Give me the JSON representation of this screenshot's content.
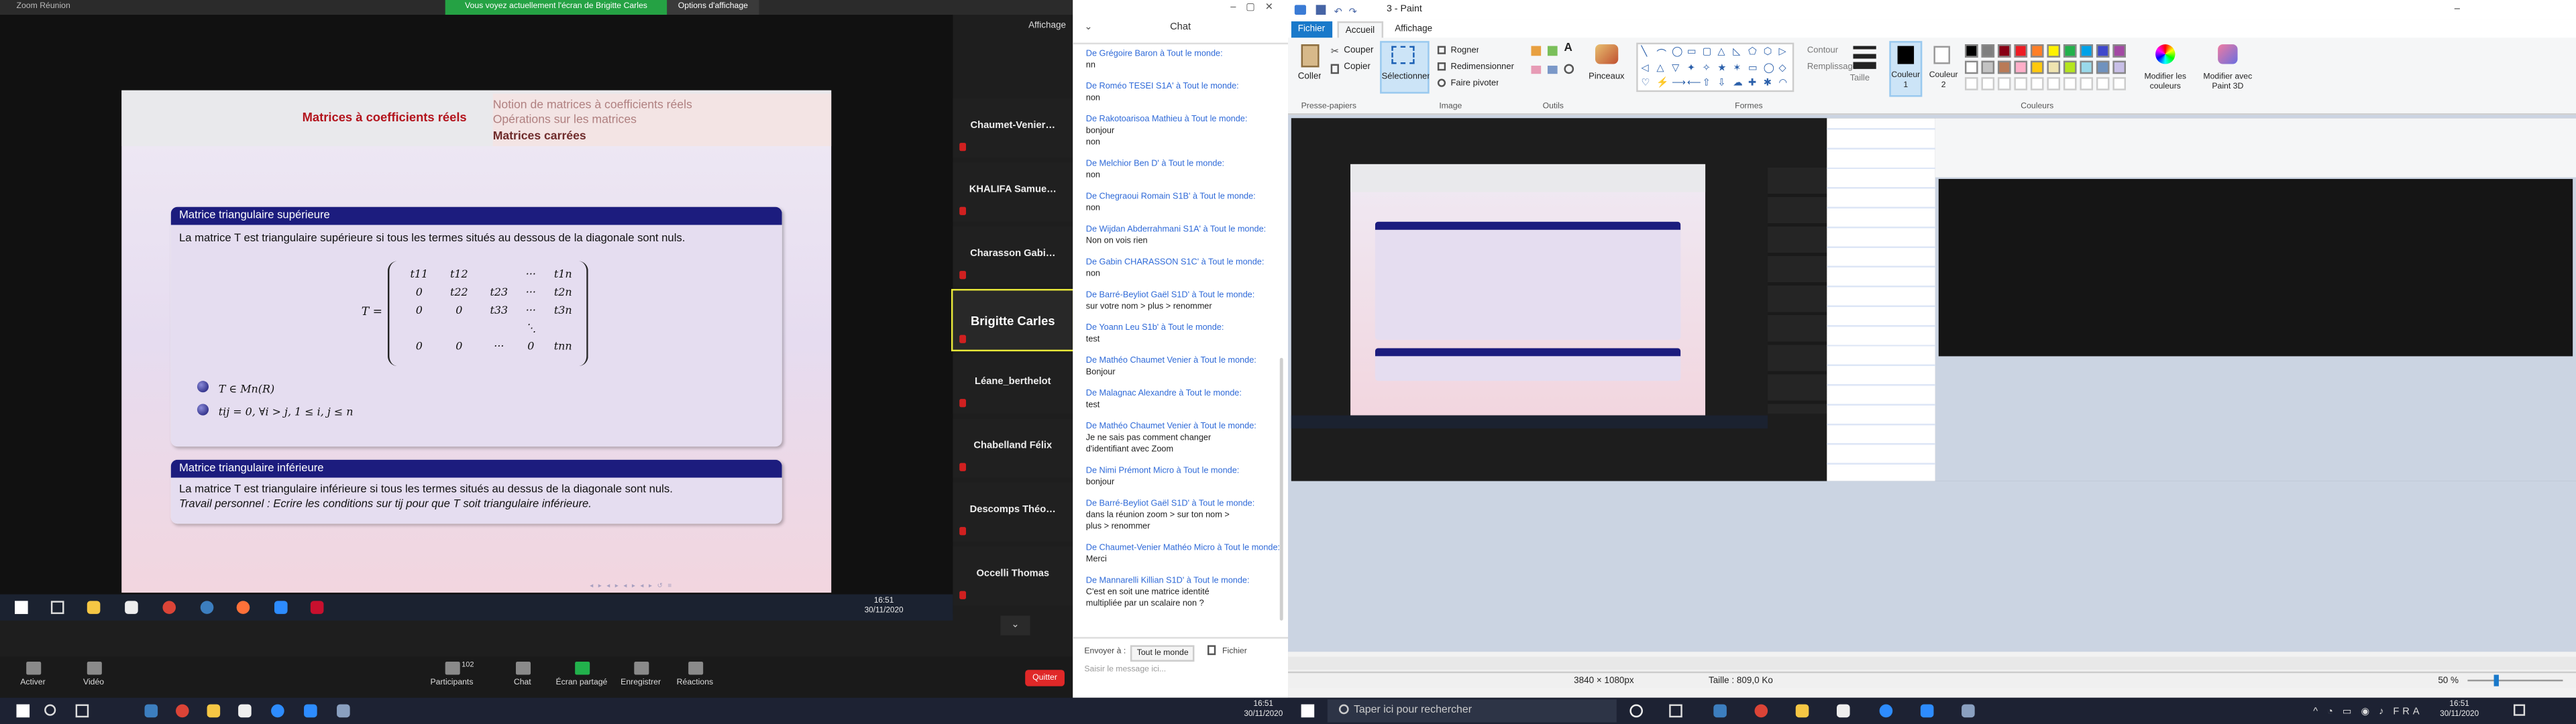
{
  "zoom": {
    "title": "Zoom Réunion",
    "banner": "Vous voyez actuellement l'écran de Brigitte Carles",
    "banner_options": "Options d'affichage",
    "view_label": "Affichage",
    "slide": {
      "title_red": "Matrices à coefficients réels",
      "nav": [
        "Notion de matrices à coefficients réels",
        "Opérations sur les matrices",
        "Matrices carrées"
      ],
      "block1_title": "Matrice triangulaire supérieure",
      "block1_text": "La matrice T est triangulaire supérieure si tous les termes situés au dessous de la diagonale sont nuls.",
      "T_label": "T =",
      "mat_rows": [
        [
          "t11",
          "t12",
          "",
          "···",
          "t1n"
        ],
        [
          "0",
          "t22",
          "t23",
          "···",
          "t2n"
        ],
        [
          "0",
          "0",
          "t33",
          "···",
          "t3n"
        ],
        [
          "",
          "",
          "",
          "⋱",
          ""
        ],
        [
          "0",
          "0",
          "···",
          "0",
          "tnn"
        ]
      ],
      "bullet1": "T ∈ Mn(R)",
      "bullet2": "tij = 0, ∀i > j, 1 ≤ i, j ≤ n",
      "block2_title": "Matrice triangulaire inférieure",
      "block2_text": "La matrice T est triangulaire inférieure si tous les termes situés au dessus de la diagonale sont nuls.",
      "block2_italic": "Travail personnel : Ecrire les conditions sur tij pour que T soit triangulaire inférieure."
    },
    "participants_tiles": [
      "Chaumet-Venier…",
      "KHALIFA Samue…",
      "Charasson Gabi…",
      "Brigitte Carles",
      "Léane_berthelot",
      "Chabelland Félix",
      "Descomps Théo…",
      "Occelli Thomas"
    ],
    "remote_time": "16:51",
    "remote_date": "30/11/2020",
    "controls": [
      {
        "label": "Activer",
        "color": "#8a8a8a"
      },
      {
        "label": "Vidéo",
        "color": "#8a8a8a"
      },
      {
        "label": "Participants",
        "color": "#8a8a8a",
        "count": "102"
      },
      {
        "label": "Chat",
        "color": "#8a8a8a"
      },
      {
        "label": "Écran partagé",
        "color": "#22b14c"
      },
      {
        "label": "Enregistrer",
        "color": "#8a8a8a"
      },
      {
        "label": "Réactions",
        "color": "#8a8a8a"
      }
    ],
    "quit": "Quitter"
  },
  "chat": {
    "title": "Chat",
    "messages": [
      {
        "from": "De Grégoire Baron à Tout le monde:",
        "body": "nn"
      },
      {
        "from": "De Roméo TESEI S1A' à Tout le monde:",
        "body": "non"
      },
      {
        "from": "De Rakotoarisoa Mathieu à Tout le monde:",
        "body": "bonjour\nnon"
      },
      {
        "from": "De Melchior Ben D' à Tout le monde:",
        "body": "non"
      },
      {
        "from": "De Chegraoui Romain S1B' à Tout le monde:",
        "body": "non"
      },
      {
        "from": "De Wijdan Abderrahmani S1A' à Tout le monde:",
        "body": "Non on vois rien"
      },
      {
        "from": "De Gabin CHARASSON S1C' à Tout le monde:",
        "body": "non"
      },
      {
        "from": "De Barré-Beyliot Gaël S1D' à Tout le monde:",
        "body": "sur votre nom > plus > renommer"
      },
      {
        "from": "De Yoann Leu S1b' à Tout le monde:",
        "body": "test"
      },
      {
        "from": "De Mathéo Chaumet Venier à Tout le monde:",
        "body": "Bonjour"
      },
      {
        "from": "De Malagnac Alexandre à Tout le monde:",
        "body": "test"
      },
      {
        "from": "De Mathéo Chaumet Venier à Tout le monde:",
        "body": "Je ne sais pas comment changer\nd'identifiant avec Zoom"
      },
      {
        "from": "De Nimi Prémont Micro à Tout le monde:",
        "body": "bonjour"
      },
      {
        "from": "De Barré-Beyliot Gaël S1D' à Tout le monde:",
        "body": "dans la réunion zoom > sur ton nom >\nplus > renommer"
      },
      {
        "from": "De Chaumet-Venier Mathéo Micro à Tout le monde:",
        "body": "Merci"
      },
      {
        "from": "De Mannarelli Killian S1D' à Tout le monde:",
        "body": "C'est en soit une matrice identité\nmultipliée par un scalaire non ?"
      }
    ],
    "send_to_label": "Envoyer à :",
    "send_to_value": "Tout le monde",
    "file_label": "Fichier",
    "input_placeholder": "Saisir le message ici..."
  },
  "paint": {
    "title": "3 - Paint",
    "tabs": [
      "Fichier",
      "Accueil",
      "Affichage"
    ],
    "clipboard": {
      "paste": "Coller",
      "cut": "Couper",
      "copy": "Copier",
      "label": "Presse-papiers"
    },
    "image": {
      "select": "Sélectionner",
      "crop": "Rogner",
      "resize": "Redimensionner",
      "rotate": "Faire pivoter",
      "label": "Image"
    },
    "tools_label": "Outils",
    "brushes": "Pinceaux",
    "shapes_label": "Formes",
    "contour": "Contour",
    "fill": "Remplissage",
    "size": "Taille",
    "color1": "Couleur 1",
    "color2": "Couleur 2",
    "colors_label": "Couleurs",
    "edit_colors": "Modifier les couleurs",
    "paint3d": "Modifier avec Paint 3D",
    "palette": [
      "#000000",
      "#7f7f7f",
      "#880015",
      "#ed1c24",
      "#ff7f27",
      "#fff200",
      "#22b14c",
      "#00a2e8",
      "#3f48cc",
      "#a349a4",
      "#ffffff",
      "#c3c3c3",
      "#b97a57",
      "#ffaec9",
      "#ffc90e",
      "#efe4b0",
      "#b5e61d",
      "#99d9ea",
      "#7092be",
      "#c8bfe7"
    ],
    "status_dims": "3840 × 1080px",
    "status_size": "Taille : 809,0 Ko",
    "zoom_level": "50 %"
  },
  "taskbar": {
    "search": "Taper ici pour rechercher",
    "time_left": "16:51",
    "date_left": "30/11/2020",
    "time_right": "16:51",
    "date_right": "30/11/2020"
  }
}
